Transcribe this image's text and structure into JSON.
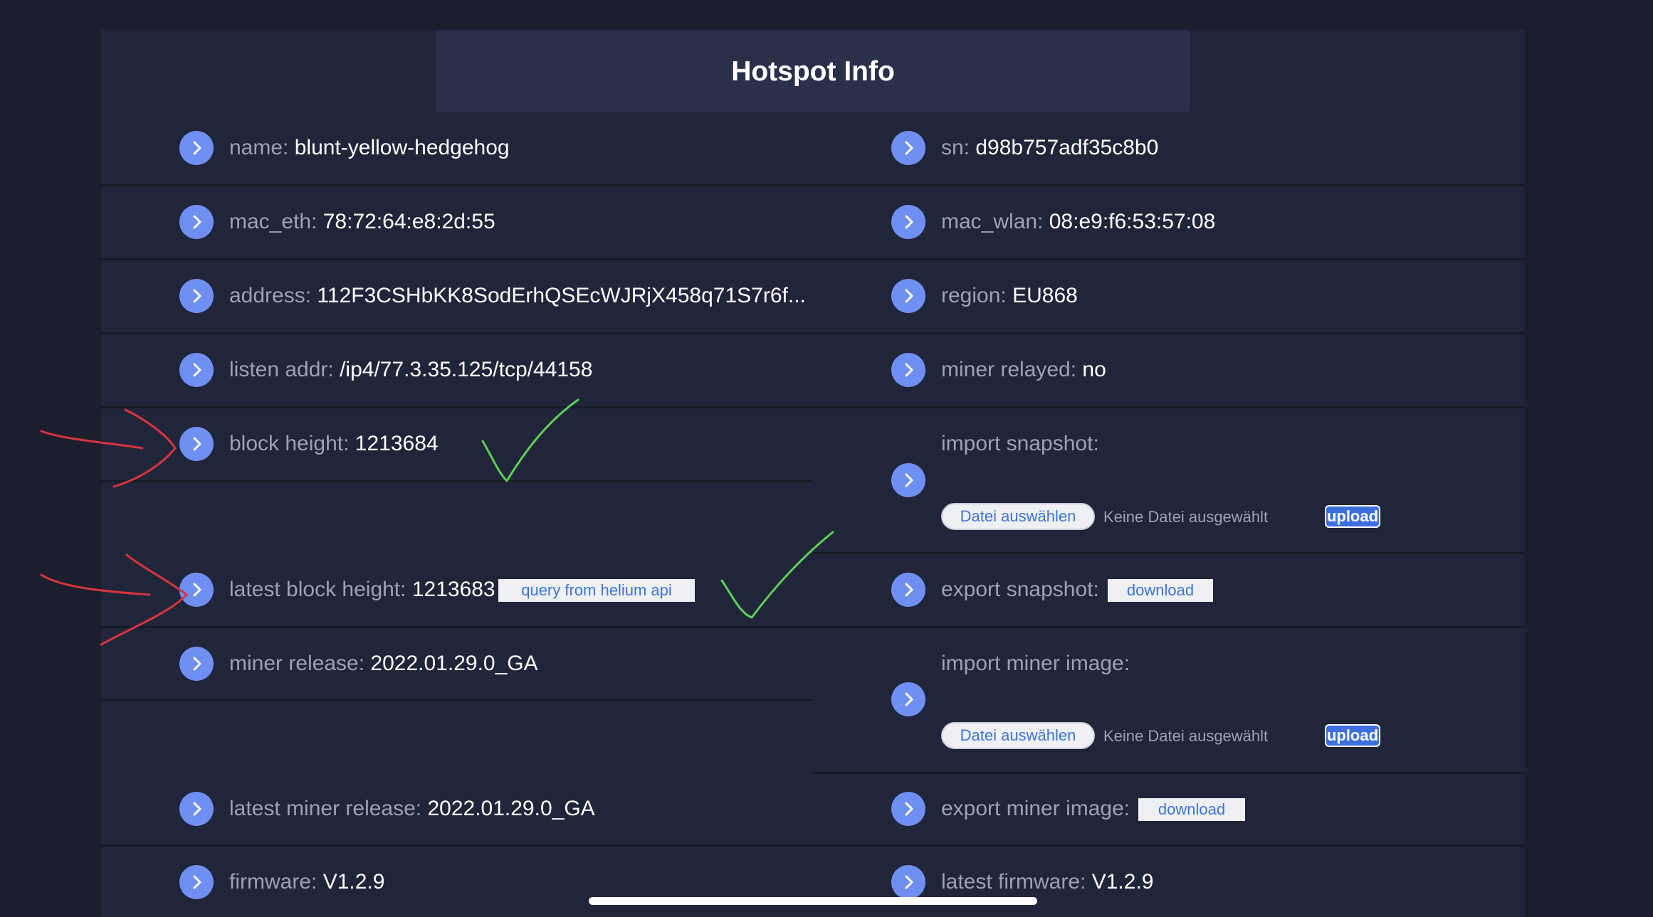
{
  "title": "Hotspot Info",
  "icon": "chevron-right-icon",
  "colors": {
    "background": "#1b1e2c",
    "panel": "#21253a",
    "title_box": "#2b3049",
    "icon": "#6f8ff2",
    "label": "#9aa1b8",
    "value": "#ffffff",
    "link": "#3f74d8",
    "annotation_red": "#d8343c",
    "annotation_green": "#5fcf55"
  },
  "left": {
    "name": {
      "label": "name:",
      "value": "blunt-yellow-hedgehog"
    },
    "mac_eth": {
      "label": "mac_eth:",
      "value": "78:72:64:e8:2d:55"
    },
    "address": {
      "label": "address:",
      "value": "112F3CSHbKK8SodErhQSEcWJRjX458q71S7r6f..."
    },
    "listen_addr": {
      "label": "listen addr:",
      "value": "/ip4/77.3.35.125/tcp/44158"
    },
    "block_height": {
      "label": "block height:",
      "value": "1213684"
    },
    "latest_block_height": {
      "label": "latest block height:",
      "value": "1213683",
      "button": "query from helium api"
    },
    "miner_release": {
      "label": "miner release:",
      "value": "2022.01.29.0_GA"
    },
    "latest_miner_release": {
      "label": "latest miner release:",
      "value": "2022.01.29.0_GA"
    },
    "firmware": {
      "label": "firmware:",
      "value": "V1.2.9"
    }
  },
  "right": {
    "sn": {
      "label": "sn:",
      "value": "d98b757adf35c8b0"
    },
    "mac_wlan": {
      "label": "mac_wlan:",
      "value": "08:e9:f6:53:57:08"
    },
    "region": {
      "label": "region:",
      "value": "EU868"
    },
    "miner_relayed": {
      "label": "miner relayed:",
      "value": "no"
    },
    "import_snapshot": {
      "label": "import snapshot:",
      "choose": "Datei auswählen",
      "status": "Keine Datei ausgewählt",
      "upload": "upload"
    },
    "export_snapshot": {
      "label": "export snapshot:",
      "button": "download"
    },
    "import_miner_image": {
      "label": "import miner image:",
      "choose": "Datei auswählen",
      "status": "Keine Datei ausgewählt",
      "upload": "upload"
    },
    "export_miner_image": {
      "label": "export miner image:",
      "button": "download"
    },
    "latest_firmware": {
      "label": "latest firmware:",
      "value": "V1.2.9"
    }
  }
}
